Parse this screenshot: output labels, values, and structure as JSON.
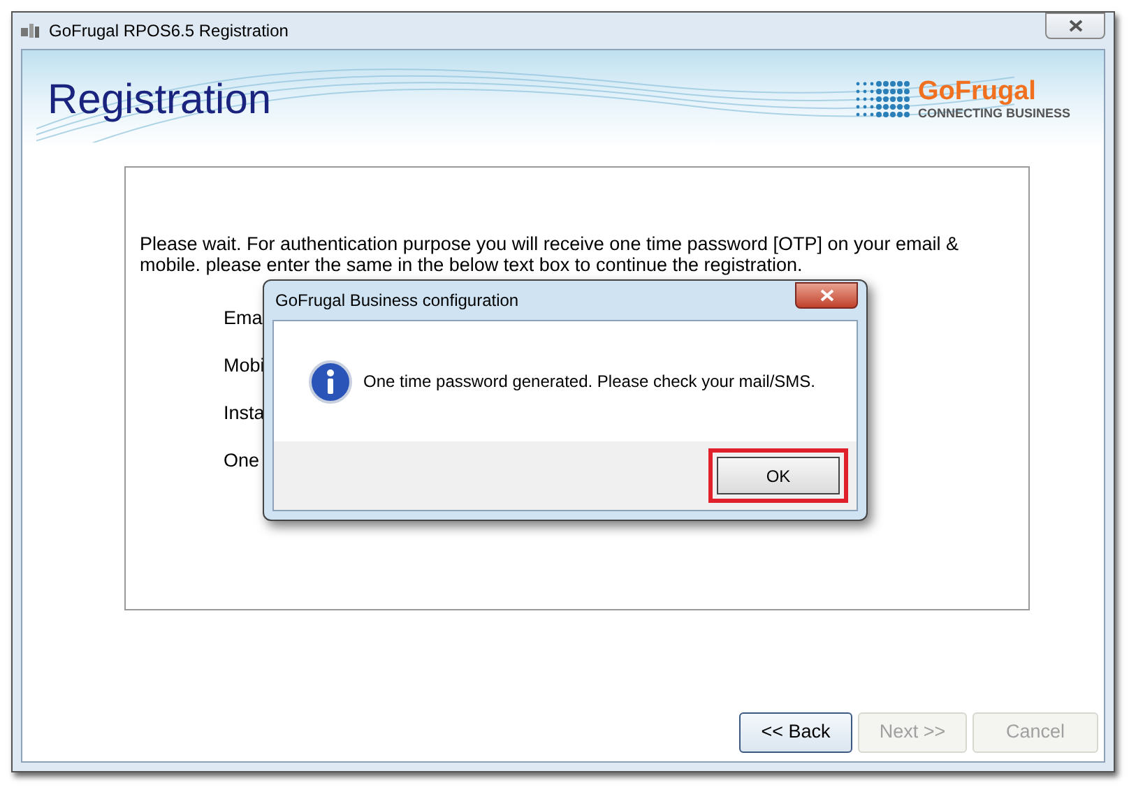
{
  "window": {
    "title": "GoFrugal RPOS6.5 Registration"
  },
  "header": {
    "title": "Registration",
    "logo": {
      "name": "GoFrugal",
      "tagline": "CONNECTING BUSINESS"
    }
  },
  "instructions": "Please wait. For authentication purpose you will receive one time password [OTP] on your email & mobile. please enter the same in the below text box to continue the registration.",
  "form_labels": [
    "Ema",
    "Mobi",
    "Insta",
    "One"
  ],
  "buttons": [
    {
      "label": "<< Back",
      "disabled": false
    },
    {
      "label": "Next >>",
      "disabled": true
    },
    {
      "label": "Cancel",
      "disabled": true
    }
  ],
  "dialog": {
    "title": "GoFrugal Business configuration",
    "message": "One time password generated. Please check your mail/SMS.",
    "button": {
      "label": "OK",
      "highlighted": true
    }
  }
}
